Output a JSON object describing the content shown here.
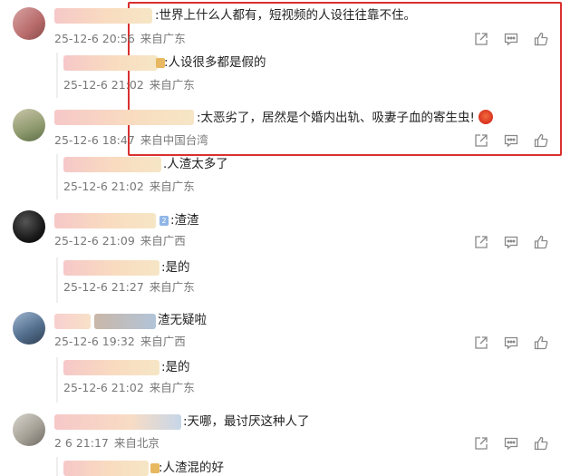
{
  "comments": [
    {
      "text": ":世界上什么人都有，短视频的人设往往靠不住。",
      "time": "25-12-6 20:56",
      "location": "来自广东"
    },
    {
      "text": ":人设很多都是假的",
      "time": "25-12-6 21:02",
      "location": "来自广东"
    },
    {
      "text": ":太恶劣了，居然是个婚内出轨、吸妻子血的寄生虫!",
      "time": "25-12-6 18:47",
      "location": "来自中国台湾"
    },
    {
      "text": ".人渣太多了",
      "time": "25-12-6 21:02",
      "location": "来自广东"
    },
    {
      "text": ":渣渣",
      "time": "25-12-6 21:09",
      "location": "来自广西"
    },
    {
      "text": ":是的",
      "time": "25-12-6 21:27",
      "location": "来自广东"
    },
    {
      "text": "渣无疑啦",
      "time": "25-12-6 19:32",
      "location": "来自广西"
    },
    {
      "text": ":是的",
      "time": "25-12-6 21:02",
      "location": "来自广东"
    },
    {
      "text": ":天哪，最讨厌这种人了",
      "time": "2 6 21:17",
      "location": "来自北京"
    },
    {
      "text": ":人渣混的好",
      "time": "",
      "location": ""
    }
  ],
  "icons": [
    "share-icon",
    "comment-icon",
    "like-icon"
  ],
  "colors": {
    "highlight": "#d9302f",
    "meta": "#777777"
  }
}
